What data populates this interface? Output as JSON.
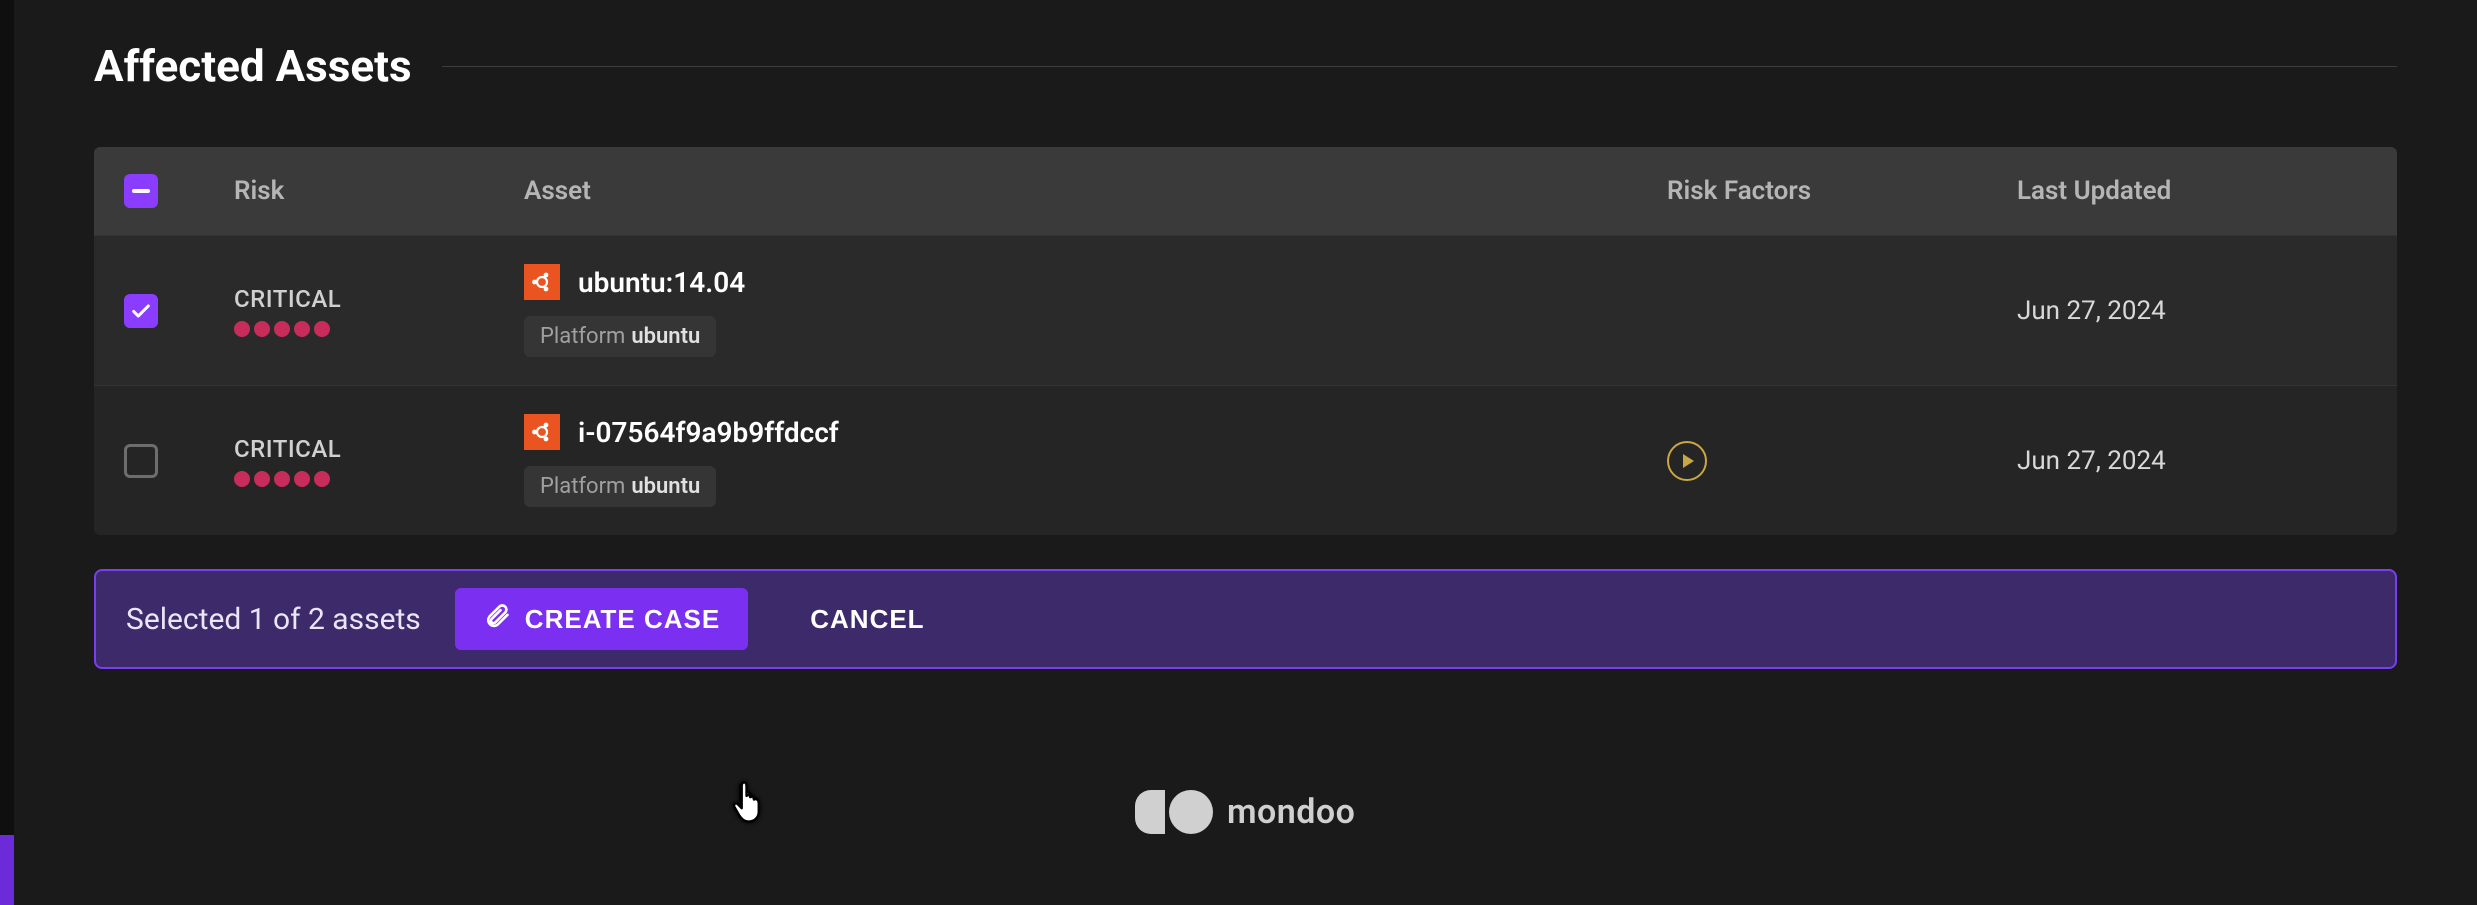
{
  "section": {
    "title": "Affected Assets"
  },
  "table": {
    "headers": {
      "risk": "Risk",
      "asset": "Asset",
      "risk_factors": "Risk Factors",
      "last_updated": "Last Updated"
    },
    "rows": [
      {
        "checked": true,
        "risk_label": "CRITICAL",
        "risk_dots": 5,
        "os_icon": "ubuntu",
        "asset_name": "ubuntu:14.04",
        "platform_key": "Platform",
        "platform_value": "ubuntu",
        "has_play": false,
        "last_updated": "Jun 27, 2024"
      },
      {
        "checked": false,
        "risk_label": "CRITICAL",
        "risk_dots": 5,
        "os_icon": "ubuntu",
        "asset_name": "i-07564f9a9b9ffdccf",
        "platform_key": "Platform",
        "platform_value": "ubuntu",
        "has_play": true,
        "last_updated": "Jun 27, 2024"
      }
    ]
  },
  "action_bar": {
    "selection_text": "Selected 1 of 2 assets",
    "create_case": "CREATE CASE",
    "cancel": "CANCEL"
  },
  "footer": {
    "brand": "mondoo"
  }
}
